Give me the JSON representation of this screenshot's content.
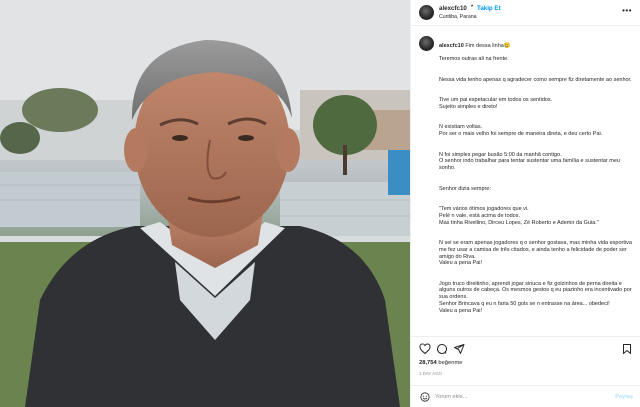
{
  "post": {
    "username": "alexcfc10",
    "separator": "•",
    "follow_label": "Takip Et",
    "location": "Curitiba, Parana",
    "caption_lead": "Fim dessa linha",
    "caption_emoji": "😢",
    "caption_paragraphs": [
      "Teremos outras ali na frente.",
      "Nessa vida tenho apenas q agradecer como sempre fiz diretamente ao senhor.",
      "Tive um pai espetacular em todos os sentidos.\nSujeito simples e direto!",
      "N existiam voltas.\nPor ser o mais velho foi sempre de maneira direta, e deu certo Pai.",
      "N foi simples pegar busão 5:00 da manhã contigo.\nO senhor indo trabalhar para tentar sustentar uma família e sustentar meu sonho.",
      "Senhor dizia sempre:",
      "\"Tem vários ótimos jogadores que vi.\nPelé n vale, está acima de todos.\nMas tinha Rivellino, Dirceu Lopes, Zé Roberto e Ademir da Guia.\"",
      "N sei se eram apenas jogadores q o senhor gostava, mas minha vida esportiva me fez usar a camisa de três citados, e ainda tenho a felicidade de poder ser amigo do Riva.\nValeu a pena Pai!",
      "Jogo truco direitinho, aprendi jogar sinuca e fiz golzinhos de perna direita e alguns outros de cabeça. Os mesmos gestos q eu piazinho era incentivado por sua ordens.\nSenhor Brincava q eu n faria 50 gols se n entrasse na área... obedeci!\nValeu a pena Pai!"
    ],
    "likes_count": "28,754",
    "likes_label": "beğenme",
    "time_ago": "1 DAY AGO",
    "comment_placeholder": "Yorum ekle...",
    "share_label": "Paylaş"
  },
  "icons": {
    "more": "more-options-icon",
    "like": "heart-icon",
    "comment": "comment-icon",
    "share": "send-icon",
    "save": "bookmark-icon",
    "emoji": "emoji-icon"
  },
  "colors": {
    "accent": "#0095f6",
    "text": "#262626",
    "muted": "#8e8e8e"
  }
}
